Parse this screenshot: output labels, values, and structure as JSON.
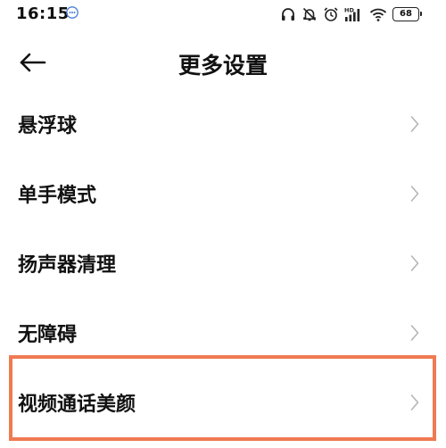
{
  "status_bar": {
    "time": "16:15",
    "battery": "68",
    "icons": [
      "headphones-icon",
      "mute-bell-icon",
      "alarm-icon",
      "hd-signal-icon",
      "wifi-icon",
      "battery-icon"
    ]
  },
  "header": {
    "title": "更多设置",
    "back_icon": "arrow-left-icon"
  },
  "settings": {
    "items": [
      {
        "label": "悬浮球"
      },
      {
        "label": "单手模式"
      },
      {
        "label": "扬声器清理"
      },
      {
        "label": "无障碍"
      },
      {
        "label": "视频通话美颜",
        "highlighted": true
      }
    ],
    "chevron_icon": "chevron-right-icon"
  },
  "colors": {
    "highlight": "#f07a52",
    "chevron": "#b5b5b5"
  }
}
